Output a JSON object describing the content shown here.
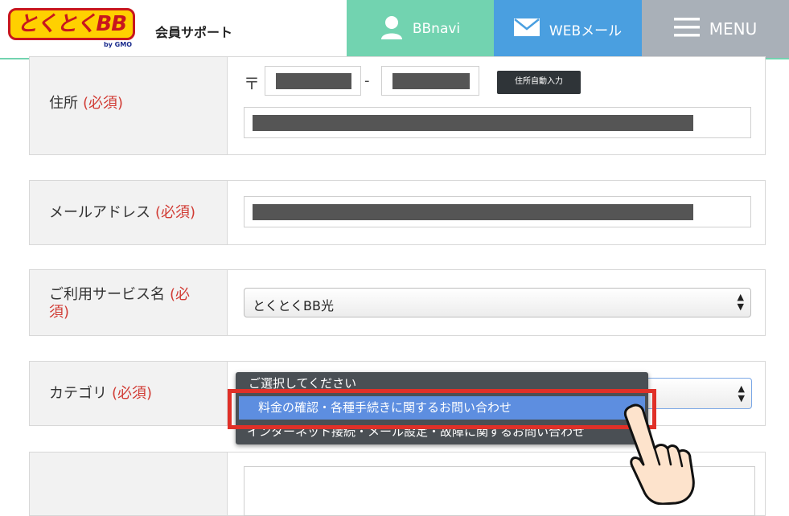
{
  "header": {
    "logo_text": "とくとくBB",
    "logo_sub": "by GMO",
    "title": "会員サポート",
    "bbnavi_label": "BBnavi",
    "webmail_label": "WEBメール",
    "menu_label": "MENU"
  },
  "colors": {
    "bbnavi_bg": "#72d3b0",
    "webmail_bg": "#4a9fe0",
    "menu_bg": "#a9b0b8",
    "required_red": "#d13c35",
    "highlight_red": "#e03028",
    "option_selected_blue": "#5d8ee0"
  },
  "form": {
    "address": {
      "label": "住所",
      "required": "(必須)",
      "zip_mark": "〒",
      "zip_dash": "-",
      "auto_button": "住所自動入力"
    },
    "email": {
      "label": "メールアドレス",
      "required": "(必須)"
    },
    "service": {
      "label_line1": "ご利用サービス名",
      "required_line1": "(必",
      "required_line2": "須)",
      "selected_value": "とくとくBB光"
    },
    "category": {
      "label": "カテゴリ",
      "required": "(必須)",
      "options": [
        "ご選択してください",
        "料金の確認・各種手続きに関するお問い合わせ",
        "インターネット接続・メール設定・故障に関するお問い合わせ"
      ]
    }
  },
  "icons": {
    "bbnavi": "user-icon",
    "webmail": "mail-icon",
    "menu": "hamburger-icon",
    "select_arrow": "up-down-arrow-icon",
    "pointer": "hand-pointer-icon"
  }
}
